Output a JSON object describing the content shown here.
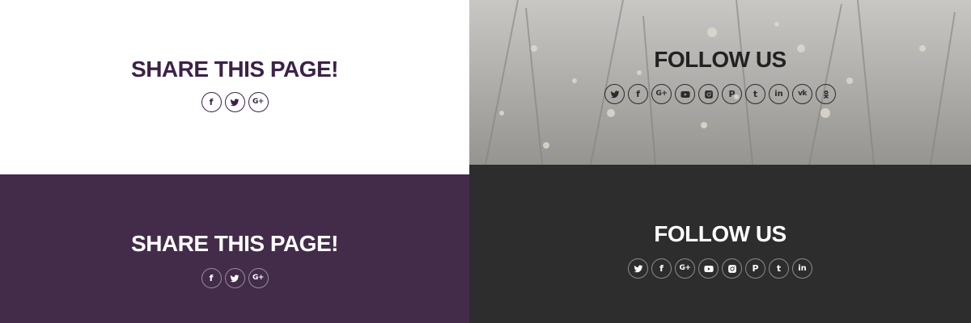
{
  "share_light": {
    "title": "SHARE THIS PAGE!",
    "icons": [
      "facebook-icon",
      "twitter-icon",
      "google-plus-icon"
    ]
  },
  "follow_photo": {
    "title": "FOLLOW US",
    "icons": [
      "twitter-icon",
      "facebook-icon",
      "google-plus-icon",
      "youtube-icon",
      "instagram-icon",
      "pinterest-icon",
      "tumblr-icon",
      "linkedin-icon",
      "vk-icon",
      "odnoklassniki-icon"
    ]
  },
  "share_dark": {
    "title": "SHARE THIS PAGE!",
    "icons": [
      "facebook-icon",
      "twitter-icon",
      "google-plus-icon"
    ]
  },
  "follow_dark": {
    "title": "FOLLOW US",
    "icons": [
      "twitter-icon",
      "facebook-icon",
      "google-plus-icon",
      "youtube-icon",
      "instagram-icon",
      "pinterest-icon",
      "tumblr-icon",
      "linkedin-icon"
    ]
  },
  "glyphs": {
    "facebook": "f",
    "google_plus": "G+",
    "pinterest": "P",
    "tumblr": "t",
    "linkedin": "in",
    "vk": "vk"
  },
  "colors": {
    "share_light_accent": "#3d2247",
    "share_dark_bg": "#432c49",
    "follow_dark_bg": "#2d2d2d",
    "follow_photo_text": "#222222"
  }
}
